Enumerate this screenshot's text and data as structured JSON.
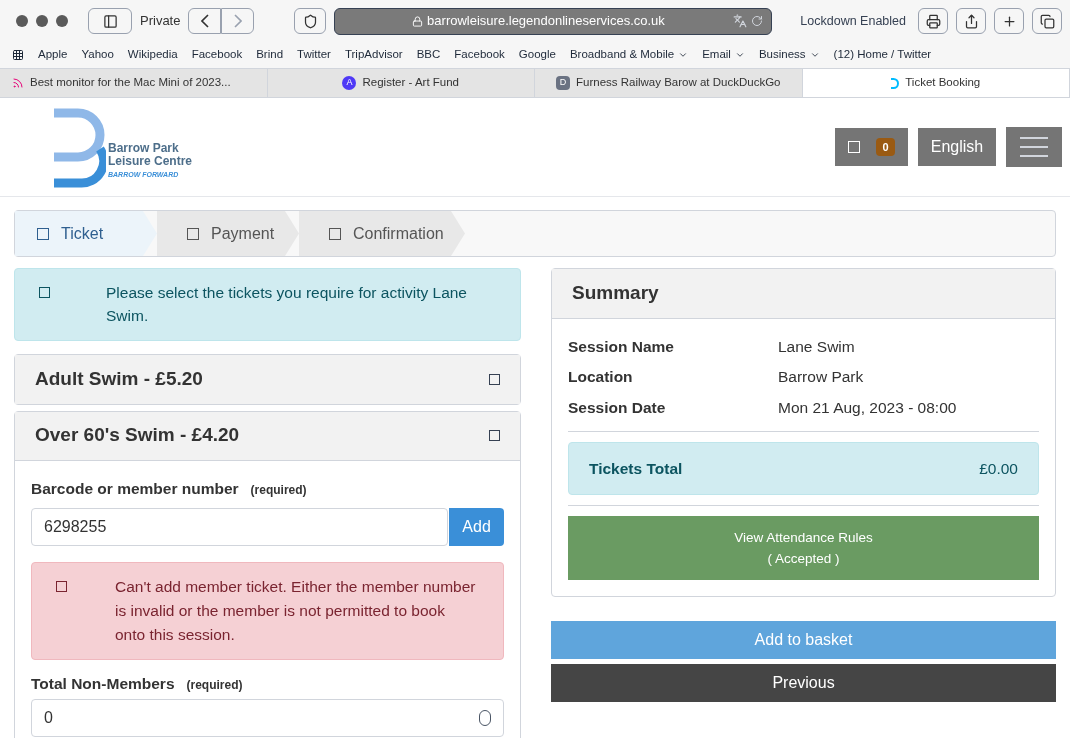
{
  "browser": {
    "private_label": "Private",
    "url": "barrowleisure.legendonlineservices.co.uk",
    "status": "Lockdown Enabled",
    "bookmarks": [
      {
        "label": "Apple",
        "menu": false
      },
      {
        "label": "Yahoo",
        "menu": false
      },
      {
        "label": "Wikipedia",
        "menu": false
      },
      {
        "label": "Facebook",
        "menu": false
      },
      {
        "label": "Brind",
        "menu": false
      },
      {
        "label": "Twitter",
        "menu": false
      },
      {
        "label": "TripAdvisor",
        "menu": false
      },
      {
        "label": "BBC",
        "menu": false
      },
      {
        "label": "Facebook",
        "menu": false
      },
      {
        "label": "Google",
        "menu": false
      },
      {
        "label": "Broadband & Mobile",
        "menu": true
      },
      {
        "label": "Email",
        "menu": true
      },
      {
        "label": "Business",
        "menu": true
      },
      {
        "label": "(12) Home / Twitter",
        "menu": false
      }
    ],
    "tabs": [
      {
        "title": "Best monitor for the Mac Mini of 2023...",
        "kind": "feed",
        "selected": false
      },
      {
        "title": "Register - Art Fund",
        "kind": "letter",
        "badge": "A",
        "selected": false
      },
      {
        "title": "Furness Railway Barow at DuckDuckGo",
        "kind": "letter",
        "badge": "D",
        "selected": false
      },
      {
        "title": "Ticket Booking",
        "kind": "logo",
        "selected": true
      }
    ]
  },
  "header": {
    "logo_lines": [
      "Barrow Park",
      "Leisure Centre"
    ],
    "logo_tagline": "BARROW FORWARD",
    "basket_count": "0",
    "language": "English"
  },
  "steps": [
    {
      "label": "Ticket",
      "selected": true
    },
    {
      "label": "Payment",
      "selected": false
    },
    {
      "label": "Confirmation",
      "selected": false
    }
  ],
  "info_alert": "Please select the tickets you require for activity Lane Swim.",
  "tickets": [
    {
      "title": "Adult Swim - £5.20",
      "expanded": false
    },
    {
      "title": "Over 60's Swim - £4.20",
      "expanded": true
    }
  ],
  "member_field": {
    "label": "Barcode or member number",
    "required": "(required)",
    "value": "6298255",
    "button": "Add"
  },
  "error_alert": "Can't add member ticket. Either the member number is invalid or the member is not permitted to book onto this session.",
  "non_members": {
    "label": "Total Non-Members",
    "required": "(required)",
    "value": "0"
  },
  "summary": {
    "title": "Summary",
    "rows": [
      {
        "label": "Session Name",
        "value": "Lane Swim"
      },
      {
        "label": "Location",
        "value": "Barrow Park"
      },
      {
        "label": "Session Date",
        "value": "Mon 21 Aug, 2023 - 08:00"
      }
    ],
    "total_label": "Tickets Total",
    "total_value": "£0.00",
    "rules_lines": [
      "View Attendance Rules",
      "( Accepted )"
    ]
  },
  "actions": [
    {
      "label": "Add to basket",
      "kind": "primary"
    },
    {
      "label": "Previous",
      "kind": "dark"
    }
  ]
}
